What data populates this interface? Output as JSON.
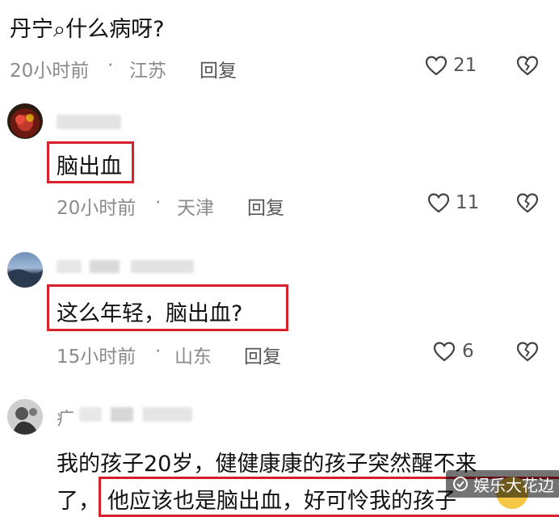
{
  "top_comment": {
    "text": "丹宁⌕什么病呀?",
    "time": "20小时前",
    "dot": "·",
    "location": "江苏",
    "reply": "回复",
    "likes": "21"
  },
  "replies": [
    {
      "text": "脑出血",
      "time": "20小时前",
      "dot": "·",
      "location": "天津",
      "reply": "回复",
      "likes": "11"
    },
    {
      "text": "这么年轻，脑出血?",
      "time": "15小时前",
      "dot": "·",
      "location": "山东",
      "reply": "回复",
      "likes": "6"
    },
    {
      "username_partial": "疒",
      "line1": "我的孩子20岁，健健康康的孩子突然醒不来",
      "line2_prefix": "了，",
      "line2_boxed": "他应该也是脑出血，好可怜我的孩子"
    }
  ],
  "watermark": {
    "text": "娱乐大花边"
  },
  "colors": {
    "highlight_red": "#d6202b",
    "meta_gray": "#8a8a8a",
    "text_black": "#111111"
  }
}
